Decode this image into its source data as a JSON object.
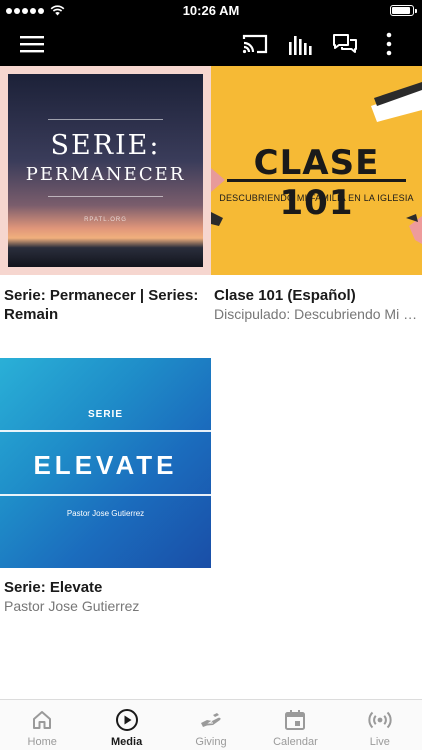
{
  "status_bar": {
    "time": "10:26 AM",
    "signal_dots": 5,
    "battery_level": 0.95
  },
  "top_nav": {
    "icons": [
      "hamburger-menu-icon",
      "cast-icon",
      "bars-icon",
      "chat-bubbles-icon",
      "more-vertical-icon"
    ]
  },
  "media_items": [
    {
      "title": "Serie: Permanecer | Series: Remain",
      "subtitle": "",
      "art": {
        "line1": "SERIE:",
        "line2": "PERMANECER",
        "small": "RPATL.ORG"
      }
    },
    {
      "title": "Clase 101 (Español)",
      "subtitle": "Discipulado: Descubriendo Mi Familia en la Iglesia",
      "art": {
        "headline": "CLASE 101",
        "tagline": "DESCUBRIENDO MI FAMILIA EN LA IGLESIA"
      }
    },
    {
      "title": "Serie: Elevate",
      "subtitle": "Pastor Jose Gutierrez",
      "art": {
        "label": "SERIE",
        "headline": "ELEVATE",
        "byline": "Pastor Jose Gutierrez"
      }
    }
  ],
  "tab_bar": {
    "active": "Media",
    "tabs": [
      {
        "label": "Home",
        "icon": "home-icon"
      },
      {
        "label": "Media",
        "icon": "play-circle-icon"
      },
      {
        "label": "Giving",
        "icon": "giving-hand-icon"
      },
      {
        "label": "Calendar",
        "icon": "calendar-icon"
      },
      {
        "label": "Live",
        "icon": "live-broadcast-icon"
      }
    ]
  },
  "colors": {
    "nav_background": "#000000",
    "active_tab": "#1a1a1a",
    "inactive_tab": "#9a9a9a",
    "clase_yellow": "#f6ba35",
    "permanecer_frame": "#f6d6cf"
  }
}
